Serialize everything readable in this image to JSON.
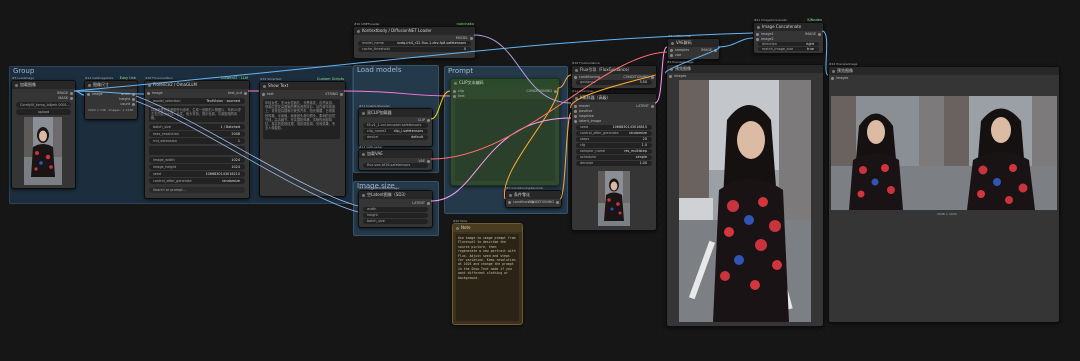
{
  "groups": [
    {
      "id": "group",
      "title": "Group",
      "color": "#1f3242"
    },
    {
      "id": "load",
      "title": "Load models",
      "color": "#28404f"
    },
    {
      "id": "prompt",
      "title": "Prompt",
      "color": "#28404f"
    },
    {
      "id": "imgsize",
      "title": "Image size",
      "color": "#28404f"
    }
  ],
  "nodes": {
    "load_image": {
      "tag": "#3 LoadImage",
      "title": "加载图像",
      "outputs": [
        "IMAGE",
        "MASK"
      ],
      "file": "ComfyUI_temp_bltjmk 0001...",
      "upload": "upload"
    },
    "get_size": {
      "tag": "#12 GetImageSize",
      "title": "图像尺寸",
      "badge": "Easy Use",
      "inputs": [
        "image"
      ],
      "outputs": [
        "width",
        "height",
        "count"
      ],
      "footer": "1024 × 136 · Images : 1 1128"
    },
    "florence": {
      "tag": "#18 Florence2Run",
      "title": "Florence2 / OmaGLLM",
      "badge": "ClowerAT · LLM",
      "inputs": [
        "image"
      ],
      "outputs": [
        "text_out"
      ],
      "model_selection_label": "model_selection",
      "model_selection_value": "TextVision · zoomed",
      "prompt_text": "将画面里的这张图作为参考，生成一张新的人物图片，年龄20岁左右的亚洲女性，长发，街头背景，提示色调，与原图相同风格。",
      "widgets": [
        {
          "label": "batch_size",
          "value": "1 / Batched"
        },
        {
          "label": "max_resolution",
          "value": "2048"
        },
        {
          "label": "rnd_extension",
          "value": "1"
        }
      ],
      "widgets2": [
        {
          "label": "image_width",
          "value": "1024"
        },
        {
          "label": "image_height",
          "value": "1024"
        },
        {
          "label": "seed",
          "value": "1066830143016210"
        },
        {
          "label": "control_after_generate",
          "value": "randomize"
        }
      ],
      "search_placeholder": "Search or prompt..."
    },
    "show_text": {
      "tag": "#19 ShowText",
      "title": "Show Text",
      "badge": "Custom Scripts",
      "inputs": [
        "text"
      ],
      "outputs": [
        "STRING"
      ],
      "text": "年轻女性，亚洲女性面孔，长黑卷发，自然妆容，穿着红蓝花朵图案的黑色透视衬衫，站在城市街道上，背景是高楼和行驶的汽车，阳光明媚，日常街拍风格，半身像，侧身回头看向镜头，柔和的自然光线，高清细节，写实摄影风格，清晰的面部特征，真实的皮肤纹理，电影感色调，景深效果，专业人像摄影。"
    },
    "load_diffusion": {
      "tag": "#10 UNETLoader",
      "title": "Kontextbody / DiffusionNET Loader",
      "badge": "nunchaku",
      "outputs": [
        "MODEL"
      ],
      "widgets": [
        {
          "label": "model_name",
          "value": "svdq-int4_r32-flux.1-dev-fp8.safetensors"
        },
        {
          "label": "cache_threshold",
          "value": "0"
        },
        {
          "label": "attention",
          "value": "nunchaku-fp16"
        },
        {
          "label": "data_type",
          "value": "bfloat16"
        }
      ]
    },
    "dual_clip": {
      "tag": "#11 DualCLIPLoader",
      "title": "双CLIP加载器",
      "outputs": [
        "CLIP"
      ],
      "widgets": [
        {
          "label": "clip_name1",
          "value": "t5-v1_1-xxl-encoder.safetensors"
        },
        {
          "label": "clip_name2",
          "value": "clip_l.safetensors"
        },
        {
          "label": "type",
          "value": "flux"
        },
        {
          "label": "device",
          "value": "default"
        }
      ]
    },
    "vae_loader": {
      "tag": "#13 VAELoader",
      "title": "加载VAE",
      "outputs": [
        "VAE"
      ],
      "widgets": [
        {
          "label": "vae_name",
          "value": "flux-vae-bf16.safetensors"
        }
      ]
    },
    "clip_encode": {
      "tag": "#6 CLIPTextEncode",
      "title": "CLIP文本编码",
      "inputs": [
        "clip",
        "text"
      ],
      "outputs": [
        "CONDITIONING"
      ]
    },
    "empty_latent": {
      "tag": "#5 EmptySD3LatentImage",
      "title": "空Latent图像（SD3）",
      "outputs": [
        "LATENT"
      ],
      "widgets": [
        {
          "label": "width",
          "value": "1024"
        },
        {
          "label": "height",
          "value": "1024"
        },
        {
          "label": "batch_size",
          "value": "1"
        }
      ]
    },
    "conditioning_zero": {
      "tag": "#7 ConditioningZeroOut",
      "title": "条件零化",
      "inputs": [
        "conditioning"
      ],
      "outputs": [
        "CONDITIONING"
      ]
    },
    "note": {
      "tag": "#20 Note",
      "title": "Note",
      "text": "Use image-to-image prompt from Florence2 to describe the source picture, then regenerate a new portrait with Flux. Adjust seed and steps for variation. Keep resolution at 1024 and change the prompt in the Show Text node if you want different clothing or background."
    },
    "ksampler": {
      "tag": "#14 KSampler",
      "title": "K采样器（高级）",
      "inputs": [
        "model",
        "positive",
        "negative",
        "latent_image"
      ],
      "outputs": [
        "LATENT"
      ],
      "widgets": [
        {
          "label": "seed",
          "value": "1066830143016815"
        },
        {
          "label": "control_after_generate",
          "value": "randomize"
        },
        {
          "label": "steps",
          "value": "20"
        },
        {
          "label": "cfg",
          "value": "1.0"
        },
        {
          "label": "sampler_name",
          "value": "res_multistep"
        },
        {
          "label": "scheduler",
          "value": "simple"
        },
        {
          "label": "denoise",
          "value": "1.00"
        }
      ]
    },
    "guidance": {
      "tag": "#16 FluxGuidance",
      "title": "Flux引导（FluxGuidance）",
      "inputs": [
        "conditioning"
      ],
      "outputs": [
        "CONDITIONING"
      ],
      "widgets": [
        {
          "label": "guidance",
          "value": "3.50"
        }
      ]
    },
    "vae_decode": {
      "tag": "#8 VAEDecode",
      "title": "VAE解码",
      "inputs": [
        "samples",
        "vae"
      ],
      "outputs": [
        "IMAGE"
      ]
    },
    "save_preview": {
      "tag": "#9 PreviewImage",
      "title": "预览图像",
      "inputs": [
        "images"
      ]
    },
    "concat": {
      "tag": "#21 ImageConcanate",
      "title": "Image Concatenate",
      "badge": "KJNodes",
      "inputs": [
        "image1",
        "image2"
      ],
      "outputs": [
        "IMAGE"
      ],
      "widgets": [
        {
          "label": "direction",
          "value": "right"
        },
        {
          "label": "match_image_size",
          "value": "true"
        }
      ]
    },
    "compare_preview": {
      "tag": "#22 PreviewImage",
      "title": "预览图像",
      "inputs": [
        "images"
      ],
      "footer": "2048 × 1024"
    }
  },
  "colors": {
    "wire_image": "#64b5f6",
    "wire_text": "#ff7ad9",
    "wire_latent": "#ff9cf9",
    "wire_clip": "#ffd500",
    "wire_vae": "#ff6e6e",
    "wire_cond": "#ffa931",
    "wire_model": "#b39ddb",
    "group_prompt_green": "#2c4a2c",
    "note_border": "#6e5b2e"
  }
}
